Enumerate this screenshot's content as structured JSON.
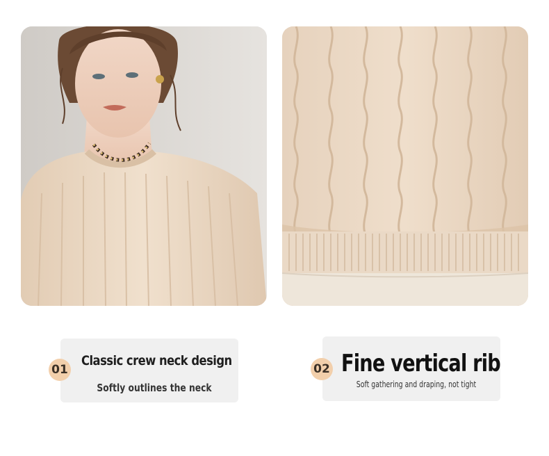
{
  "panels": [
    {
      "number": "01",
      "title": "Classic crew neck design",
      "subtitle": "Softly outlines the neck",
      "image": "woman-wearing-cable-knit-sweater-photo"
    },
    {
      "number": "02",
      "title": "Fine vertical rib",
      "subtitle": "Soft gathering and draping, not tight",
      "image": "sweater-hem-rib-closeup-photo"
    }
  ],
  "colors": {
    "badge": "#f2cfab",
    "card": "#f0f0f0",
    "knit": "#ead7c2"
  }
}
